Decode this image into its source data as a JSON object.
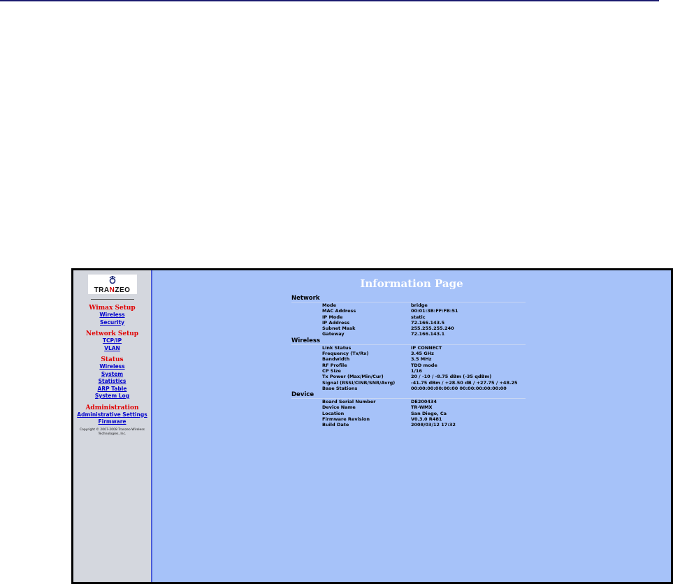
{
  "sidebar": {
    "logo_text": "TRANZEO",
    "sections": [
      {
        "title": "Wimax Setup",
        "links": [
          "Wireless",
          "Security"
        ]
      },
      {
        "title": "Network Setup",
        "links": [
          "TCP/IP",
          "VLAN"
        ]
      },
      {
        "title": "Status",
        "links": [
          "Wireless",
          "System",
          "Statistics",
          "ARP Table",
          "System Log"
        ]
      },
      {
        "title": "Administration",
        "links": [
          "Administrative Settings",
          "Firmware"
        ]
      }
    ],
    "copyright": "Copyright © 2007-2008 Tranzeo Wireless Technologies, Inc."
  },
  "main": {
    "title": "Information Page",
    "groups": [
      {
        "name": "Network",
        "rows": [
          {
            "label": "Mode",
            "value": "bridge"
          },
          {
            "label": "MAC Address",
            "value": "00:01:3B:FF:FB:51"
          },
          {
            "label": "IP Mode",
            "value": "static"
          },
          {
            "label": "IP Address",
            "value": "72.166.143.5"
          },
          {
            "label": "Subnet Mask",
            "value": "255.255.255.240"
          },
          {
            "label": "Gateway",
            "value": "72.166.143.1"
          }
        ]
      },
      {
        "name": "Wireless",
        "rows": [
          {
            "label": "Link Status",
            "value": "IP CONNECT"
          },
          {
            "label": "Frequency (Tx/Rx)",
            "value": "3.45 GHz"
          },
          {
            "label": "Bandwidth",
            "value": "3.5 MHz"
          },
          {
            "label": "RF Profile",
            "value": "TDD mode"
          },
          {
            "label": "CP Size",
            "value": "1/16"
          },
          {
            "label": "Tx Power (Max/Min/Cur)",
            "value": "20 / -10 / -8.75 dBm (-35 qdBm)"
          },
          {
            "label": "Signal (RSSI/CINR/SNR/Avrg)",
            "value": "-41.75 dBm / +28.50 dB / +27.75 / +48.25"
          },
          {
            "label": "Base Stations",
            "value": "00:00:00:00:00:00 00:00:00:00:00:00"
          }
        ]
      },
      {
        "name": "Device",
        "rows": [
          {
            "label": "Board Serial Number",
            "value": "DE200434"
          },
          {
            "label": "Device Name",
            "value": "TR-WMX"
          },
          {
            "label": "Location",
            "value": "San Diego, Ca"
          },
          {
            "label": "Firmware Revision",
            "value": "V0.3.0 R481"
          },
          {
            "label": "Build Date",
            "value": "2008/03/12 17:32"
          }
        ]
      }
    ]
  }
}
